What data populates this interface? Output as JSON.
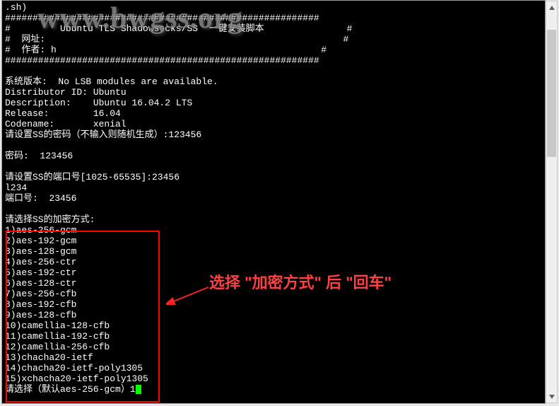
{
  "terminal": {
    "script_tail": ".sh)",
    "hash_line": "#########################################################",
    "header_title": "#         Ubuntu TLS Shadowsocks/SS  一键安装脚本               #",
    "header_url": "#  网址:                                                      #",
    "header_author": "#  作者: h                                                #",
    "sys_version_label": "系统版本:  No LSB modules are available.",
    "dist_id": "Distributor ID: Ubuntu",
    "description": "Description:    Ubuntu 16.04.2 LTS",
    "release": "Release:        16.04",
    "codename": "Codename:       xenial",
    "pwd_prompt": "请设置SS的密码（不输入则随机生成）:123456",
    "pwd_result": "密码:  123456",
    "port_prompt": "请设置SS的端口号[1025-65535]:23456",
    "port_partial": "l234",
    "port_result": "端口号:  23456",
    "cipher_header": "请选择SS的加密方式:",
    "ciphers": [
      "1)aes-256-gcm",
      "2)aes-192-gcm",
      "3)aes-128-gcm",
      "4)aes-256-ctr",
      "5)aes-192-ctr",
      "6)aes-128-ctr",
      "7)aes-256-cfb",
      "8)aes-192-cfb",
      "9)aes-128-cfb",
      "10)camellia-128-cfb",
      "11)camellia-192-cfb",
      "12)camellia-256-cfb",
      "13)chacha20-ietf",
      "14)chacha20-ietf-poly1305",
      "15)xchacha20-ietf-poly1305"
    ],
    "cipher_prompt": "请选择（默认aes-256-gcm）1"
  },
  "watermark": "www.bwgss.org",
  "annotation": "选择 \"加密方式\" 后 \"回车\""
}
